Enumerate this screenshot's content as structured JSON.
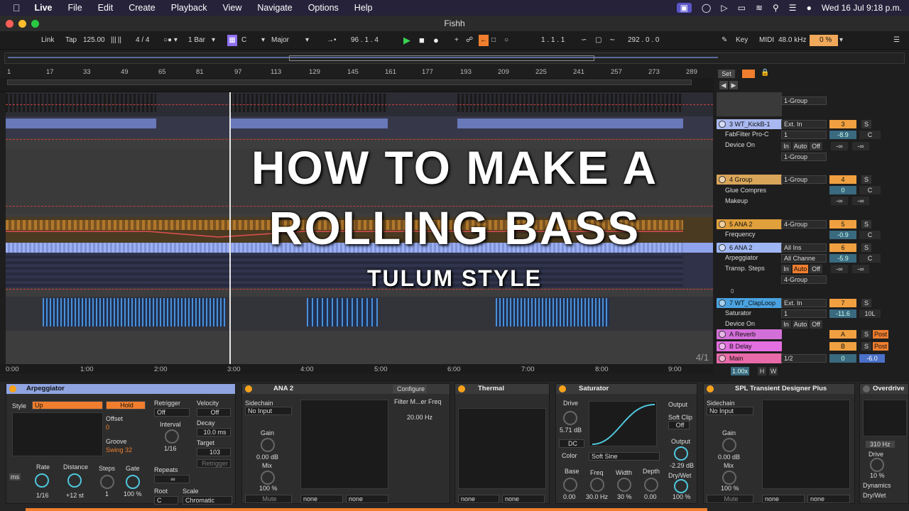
{
  "menubar": {
    "app": "Live",
    "items": [
      "File",
      "Edit",
      "Create",
      "Playback",
      "View",
      "Navigate",
      "Options",
      "Help"
    ],
    "clock": "Wed 16 Jul  9:18 p.m."
  },
  "window": {
    "title": "Fishh"
  },
  "control_bar": {
    "link": "Link",
    "tap": "Tap",
    "tempo": "125.00",
    "signature": "4 / 4",
    "quantize": "1 Bar",
    "key": "C",
    "scale": "Major",
    "position": "96 .  1 .  4",
    "loop_start": "1 .  1 .  1",
    "loop_length": "292 .  0 .  0",
    "key_btn": "Key",
    "midi_btn": "MIDI",
    "sample_rate": "48.0 kHz",
    "cpu": "0 %"
  },
  "ruler": {
    "bars": [
      "1",
      "17",
      "33",
      "49",
      "65",
      "81",
      "97",
      "113",
      "129",
      "145",
      "161",
      "177",
      "193",
      "209",
      "225",
      "241",
      "257",
      "273",
      "289"
    ],
    "set_btn": "Set"
  },
  "time_ruler": [
    "0:00",
    "1:00",
    "2:00",
    "3:00",
    "4:00",
    "5:00",
    "6:00",
    "7:00",
    "8:00",
    "9:00"
  ],
  "grid_fraction": "4/1",
  "zoom": "1.00x",
  "overlay": {
    "line1": "HOW TO MAKE A",
    "line2": "ROLLING BASS",
    "line3": "TULUM STYLE"
  },
  "mixer": {
    "top_group_route": "1-Group",
    "tracks": [
      {
        "name": "3 WT_KickB-1",
        "color": "#a9b8f0",
        "input": "Ext. In",
        "ch": "1",
        "route": "1-Group",
        "num": "3",
        "vol": "-8.9",
        "pan": "C",
        "dev1": "FabFilter Pro-C",
        "dev2": "Device On",
        "in": "In",
        "auto": "Auto",
        "off": "Off"
      },
      {
        "name": "4 Group",
        "color": "#d9a55a",
        "route": "1-Group",
        "num": "4",
        "vol": "0",
        "pan": "C",
        "dev1": "Glue Compres",
        "dev2": "Makeup"
      },
      {
        "name": "5 ANA 2",
        "color": "#e0a03c",
        "route": "4-Group",
        "num": "5",
        "vol": "-0.9",
        "pan": "C",
        "dev1": "Frequency"
      },
      {
        "name": "6 ANA 2",
        "color": "#9fb6f5",
        "input": "All Ins",
        "ch": "All Channe",
        "route": "4-Group",
        "num": "6",
        "vol": "-5.9",
        "pan": "C",
        "dev1": "Arpeggiator",
        "dev2": "Transp. Steps",
        "in": "In",
        "auto": "Auto",
        "off": "Off"
      },
      {
        "name": "7 WT_ClapLoop",
        "color": "#4aa3e0",
        "input": "Ext. In",
        "ch": "1",
        "num": "7",
        "vol": "-11.6",
        "pan": "10L",
        "dev1": "Saturator",
        "dev2": "Device On",
        "in": "In",
        "auto": "Auto",
        "off": "Off"
      },
      {
        "name": "A Reverb",
        "color": "#d36fd8",
        "num": "A",
        "post": "Post"
      },
      {
        "name": "B Delay",
        "color": "#e36fe0",
        "num": "B",
        "post": "Post"
      },
      {
        "name": "Main",
        "color": "#e86aa8",
        "route": "1/2",
        "num": "0",
        "vol": "-6.0"
      }
    ],
    "inf": "-∞",
    "solo": "S",
    "zero": "0"
  },
  "devices": {
    "arpeggiator": {
      "title": "Arpeggiator",
      "hold": "Hold",
      "style_label": "Style",
      "style": "Up",
      "offset_label": "Offset",
      "offset": "0",
      "groove_label": "Groove",
      "groove": "Swing 32",
      "retrigger_label": "Retrigger",
      "retrigger": "Off",
      "interval_label": "Interval",
      "interval": "1/16",
      "repeats_label": "Repeats",
      "repeats": "∞",
      "root_label": "Root",
      "root": "C",
      "velocity_label": "Velocity",
      "velocity": "Off",
      "decay_label": "Decay",
      "decay": "10.0 ms",
      "target_label": "Target",
      "target": "103",
      "retrigger_btn": "Retrigger",
      "scale_label": "Scale",
      "scale": "Chromatic",
      "rate_label": "Rate",
      "rate": "1/16",
      "distance_label": "Distance",
      "distance": "+12 st",
      "steps_label": "Steps",
      "steps": "1",
      "gate_label": "Gate",
      "gate": "100 %",
      "ms": "ms"
    },
    "ana2": {
      "title": "ANA 2",
      "configure": "Configure",
      "sidechain_label": "Sidechain",
      "sidechain": "No Input",
      "gain_label": "Gain",
      "gain": "0.00 dB",
      "mix_label": "Mix",
      "mix": "100 %",
      "mute": "Mute",
      "filter_label": "Filter M...er Freq",
      "filter": "20.00 Hz",
      "none1": "none",
      "none2": "none"
    },
    "thermal": {
      "title": "Thermal",
      "none1": "none",
      "none2": "none"
    },
    "saturator": {
      "title": "Saturator",
      "drive_label": "Drive",
      "drive": "5.71 dB",
      "dc": "DC",
      "color_label": "Color",
      "curve": "Soft Sine",
      "output_label": "Output",
      "softclip_label": "Soft Clip",
      "softclip": "Off",
      "output2_label": "Output",
      "output": "-2.29 dB",
      "drywet_label": "Dry/Wet",
      "drywet": "100 %",
      "base_label": "Base",
      "base": "0.00",
      "freq_label": "Freq",
      "freq": "30.0 Hz",
      "width_label": "Width",
      "width": "30 %",
      "depth_label": "Depth",
      "depth": "0.00"
    },
    "transient": {
      "title": "SPL Transient Designer Plus",
      "sidechain_label": "Sidechain",
      "sidechain": "No Input",
      "gain_label": "Gain",
      "gain": "0.00 dB",
      "mix_label": "Mix",
      "mix": "100 %",
      "mute": "Mute",
      "none1": "none",
      "none2": "none"
    },
    "overdrive": {
      "title": "Overdrive",
      "freq": "310 Hz",
      "drive_label": "Drive",
      "drive": "10 %",
      "dynamics_label": "Dynamics",
      "drywet_label": "Dry/Wet"
    }
  }
}
